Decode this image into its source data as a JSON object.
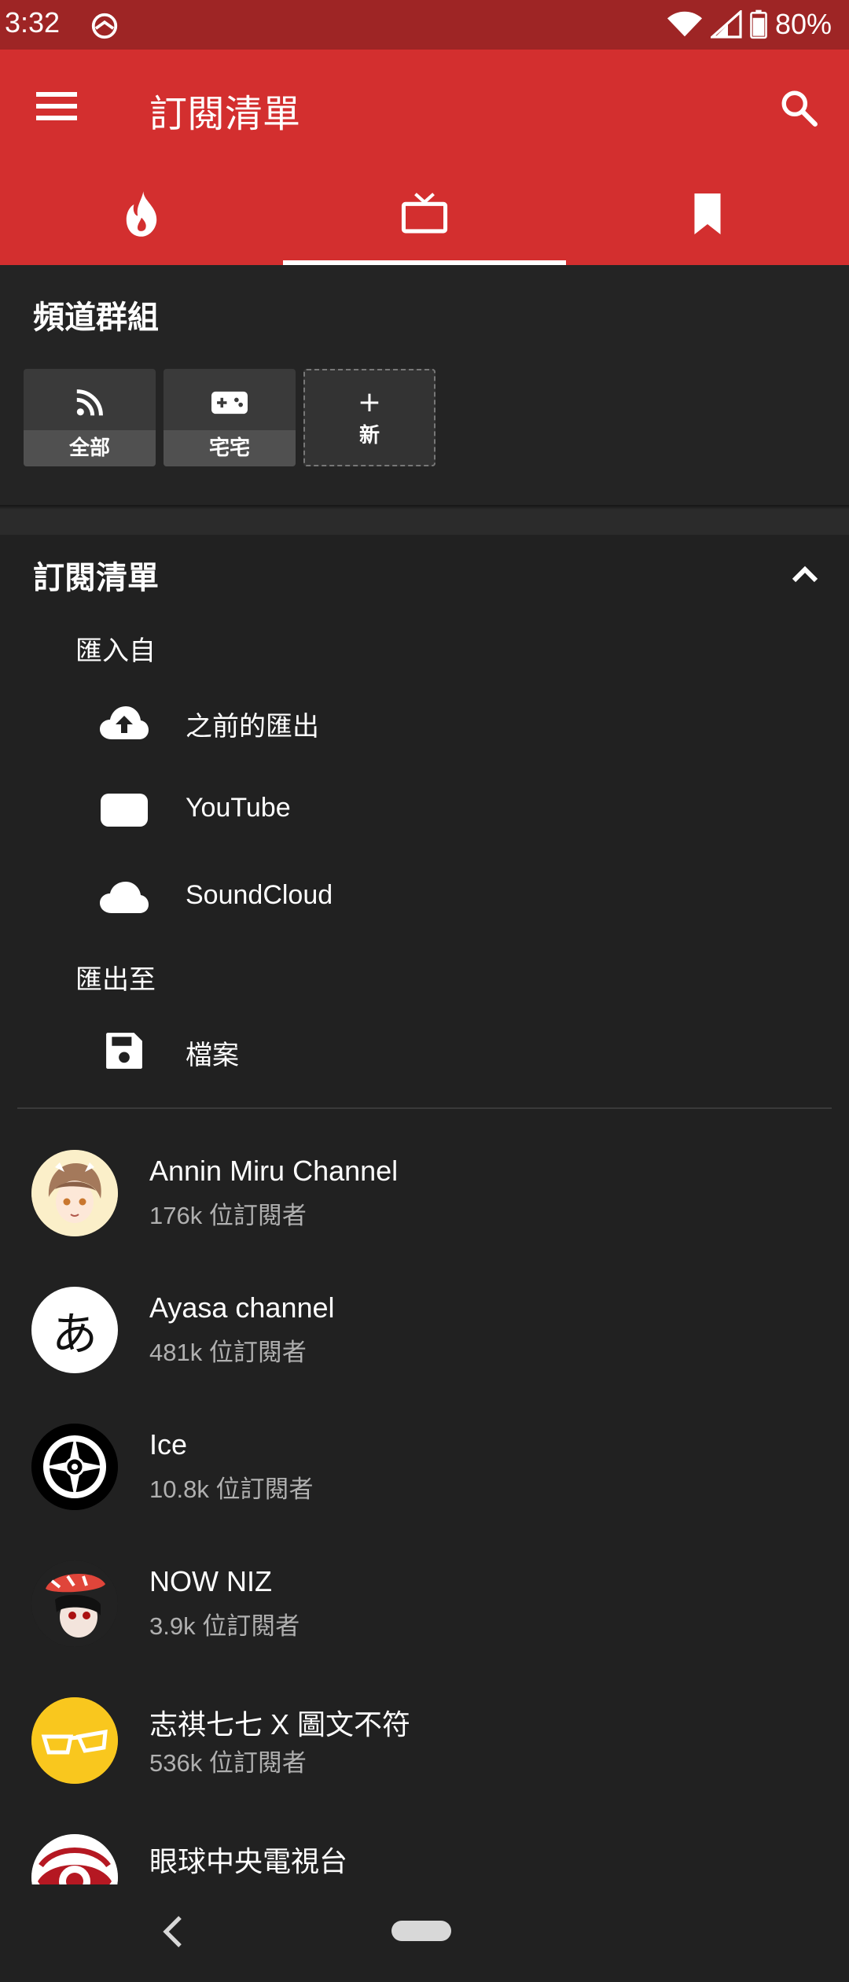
{
  "status_bar": {
    "time": "3:32",
    "battery": "80%"
  },
  "app_bar": {
    "title": "訂閱清單"
  },
  "tabs": [
    {
      "icon": "fire-icon",
      "label": "trending"
    },
    {
      "icon": "tv-icon",
      "label": "subscriptions"
    },
    {
      "icon": "bookmark-icon",
      "label": "bookmarks"
    }
  ],
  "channel_groups": {
    "title": "頻道群組",
    "items": [
      {
        "label": "全部",
        "icon": "rss-icon"
      },
      {
        "label": "宅宅",
        "icon": "gamepad-icon"
      },
      {
        "label": "新",
        "icon": "plus-icon"
      }
    ]
  },
  "subscriptions": {
    "title": "訂閱清單",
    "import_heading": "匯入自",
    "import_items": [
      {
        "label": "之前的匯出",
        "icon": "cloud-upload-icon"
      },
      {
        "label": "YouTube",
        "icon": "youtube-icon"
      },
      {
        "label": "SoundCloud",
        "icon": "cloud-icon"
      }
    ],
    "export_heading": "匯出至",
    "export_items": [
      {
        "label": "檔案",
        "icon": "save-icon"
      }
    ]
  },
  "channels": [
    {
      "name": "Annin Miru Channel",
      "subscribers": "176k 位訂閱者"
    },
    {
      "name": "Ayasa channel",
      "subscribers": "481k 位訂閱者",
      "avatar_text": "あ"
    },
    {
      "name": "Ice",
      "subscribers": "10.8k 位訂閱者"
    },
    {
      "name": "NOW NIZ",
      "subscribers": "3.9k 位訂閱者"
    },
    {
      "name": "志祺七七 X 圖文不符",
      "subscribers": "536k 位訂閱者"
    },
    {
      "name": "眼球中央電視台",
      "subscribers": ""
    }
  ],
  "colors": {
    "primary": "#d32f2f",
    "status_bar": "#9e2525",
    "background": "#212121"
  }
}
